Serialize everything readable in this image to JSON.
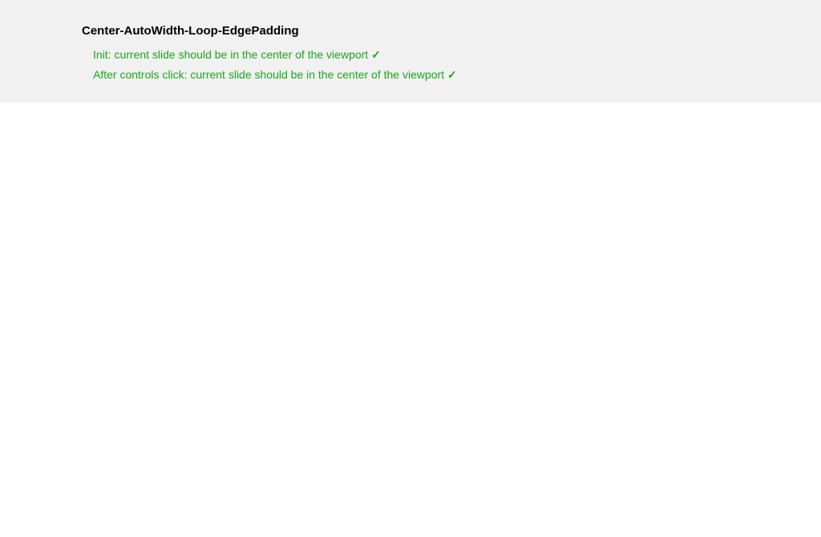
{
  "test": {
    "title": "Center-AutoWidth-Loop-EdgePadding",
    "results": [
      {
        "text": "Init: current slide should be in the center of the viewport",
        "mark": "✓"
      },
      {
        "text": "After controls click: current slide should be in the center of the viewport",
        "mark": "✓"
      }
    ]
  },
  "colors": {
    "panel_bg": "#f1f1f1",
    "pass_green": "#1ca71c"
  }
}
